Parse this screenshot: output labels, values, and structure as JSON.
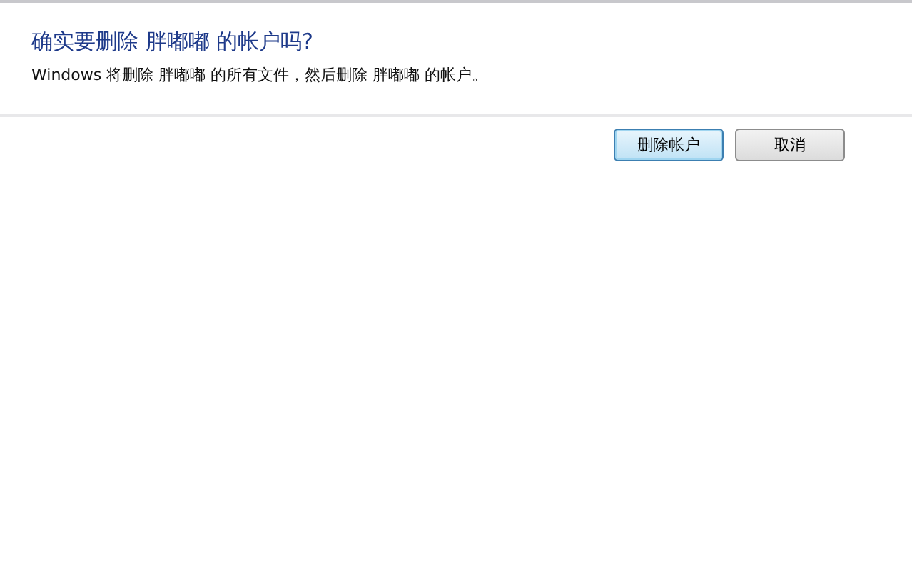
{
  "dialog": {
    "heading": "确实要删除 胖嘟嘟 的帐户吗?",
    "message": "Windows 将删除 胖嘟嘟 的所有文件，然后删除 胖嘟嘟 的帐户。"
  },
  "buttons": [
    {
      "label": "删除帐户",
      "default": true
    },
    {
      "label": "取消",
      "default": false
    }
  ]
}
